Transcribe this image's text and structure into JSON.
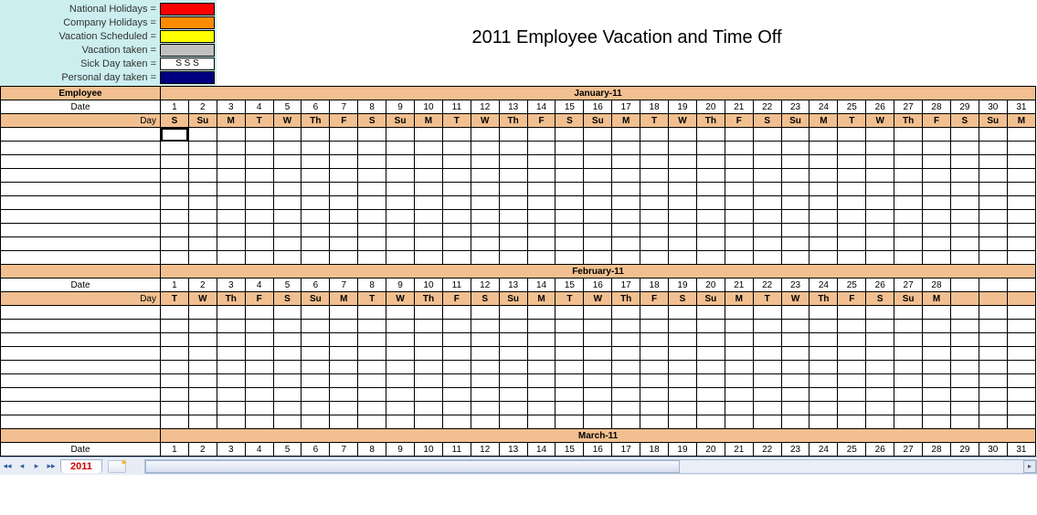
{
  "title": "2011 Employee Vacation and Time Off",
  "legend": {
    "items": [
      {
        "label": "National Holidays =",
        "color": "#ff0000",
        "text": ""
      },
      {
        "label": "Company Holidays =",
        "color": "#ff8c00",
        "text": ""
      },
      {
        "label": "Vacation Scheduled =",
        "color": "#ffff00",
        "text": ""
      },
      {
        "label": "Vacation taken =",
        "color": "#c0c0c0",
        "text": ""
      },
      {
        "label": "Sick Day taken =",
        "color": "#ffffff",
        "text": "S   S   S"
      },
      {
        "label": "Personal day taken =",
        "color": "#000080",
        "text": ""
      }
    ]
  },
  "labels": {
    "employee": "Employee",
    "date": "Date",
    "day": "Day"
  },
  "months": [
    {
      "name": "January-11",
      "dates": [
        1,
        2,
        3,
        4,
        5,
        6,
        7,
        8,
        9,
        10,
        11,
        12,
        13,
        14,
        15,
        16,
        17,
        18,
        19,
        20,
        21,
        22,
        23,
        24,
        25,
        26,
        27,
        28,
        29,
        30,
        31
      ],
      "days": [
        "S",
        "Su",
        "M",
        "T",
        "W",
        "Th",
        "F",
        "S",
        "Su",
        "M",
        "T",
        "W",
        "Th",
        "F",
        "S",
        "Su",
        "M",
        "T",
        "W",
        "Th",
        "F",
        "S",
        "Su",
        "M",
        "T",
        "W",
        "Th",
        "F",
        "S",
        "Su",
        "M"
      ],
      "blank_rows": 10
    },
    {
      "name": "February-11",
      "dates": [
        1,
        2,
        3,
        4,
        5,
        6,
        7,
        8,
        9,
        10,
        11,
        12,
        13,
        14,
        15,
        16,
        17,
        18,
        19,
        20,
        21,
        22,
        23,
        24,
        25,
        26,
        27,
        28,
        "",
        "",
        ""
      ],
      "days": [
        "T",
        "W",
        "Th",
        "F",
        "S",
        "Su",
        "M",
        "T",
        "W",
        "Th",
        "F",
        "S",
        "Su",
        "M",
        "T",
        "W",
        "Th",
        "F",
        "S",
        "Su",
        "M",
        "T",
        "W",
        "Th",
        "F",
        "S",
        "Su",
        "M",
        "",
        "",
        ""
      ],
      "blank_rows": 9
    },
    {
      "name": "March-11",
      "dates": [
        1,
        2,
        3,
        4,
        5,
        6,
        7,
        8,
        9,
        10,
        11,
        12,
        13,
        14,
        15,
        16,
        17,
        18,
        19,
        20,
        21,
        22,
        23,
        24,
        25,
        26,
        27,
        28,
        29,
        30,
        31
      ],
      "days": [],
      "blank_rows": 0
    }
  ],
  "tabs": {
    "active": "2011"
  }
}
